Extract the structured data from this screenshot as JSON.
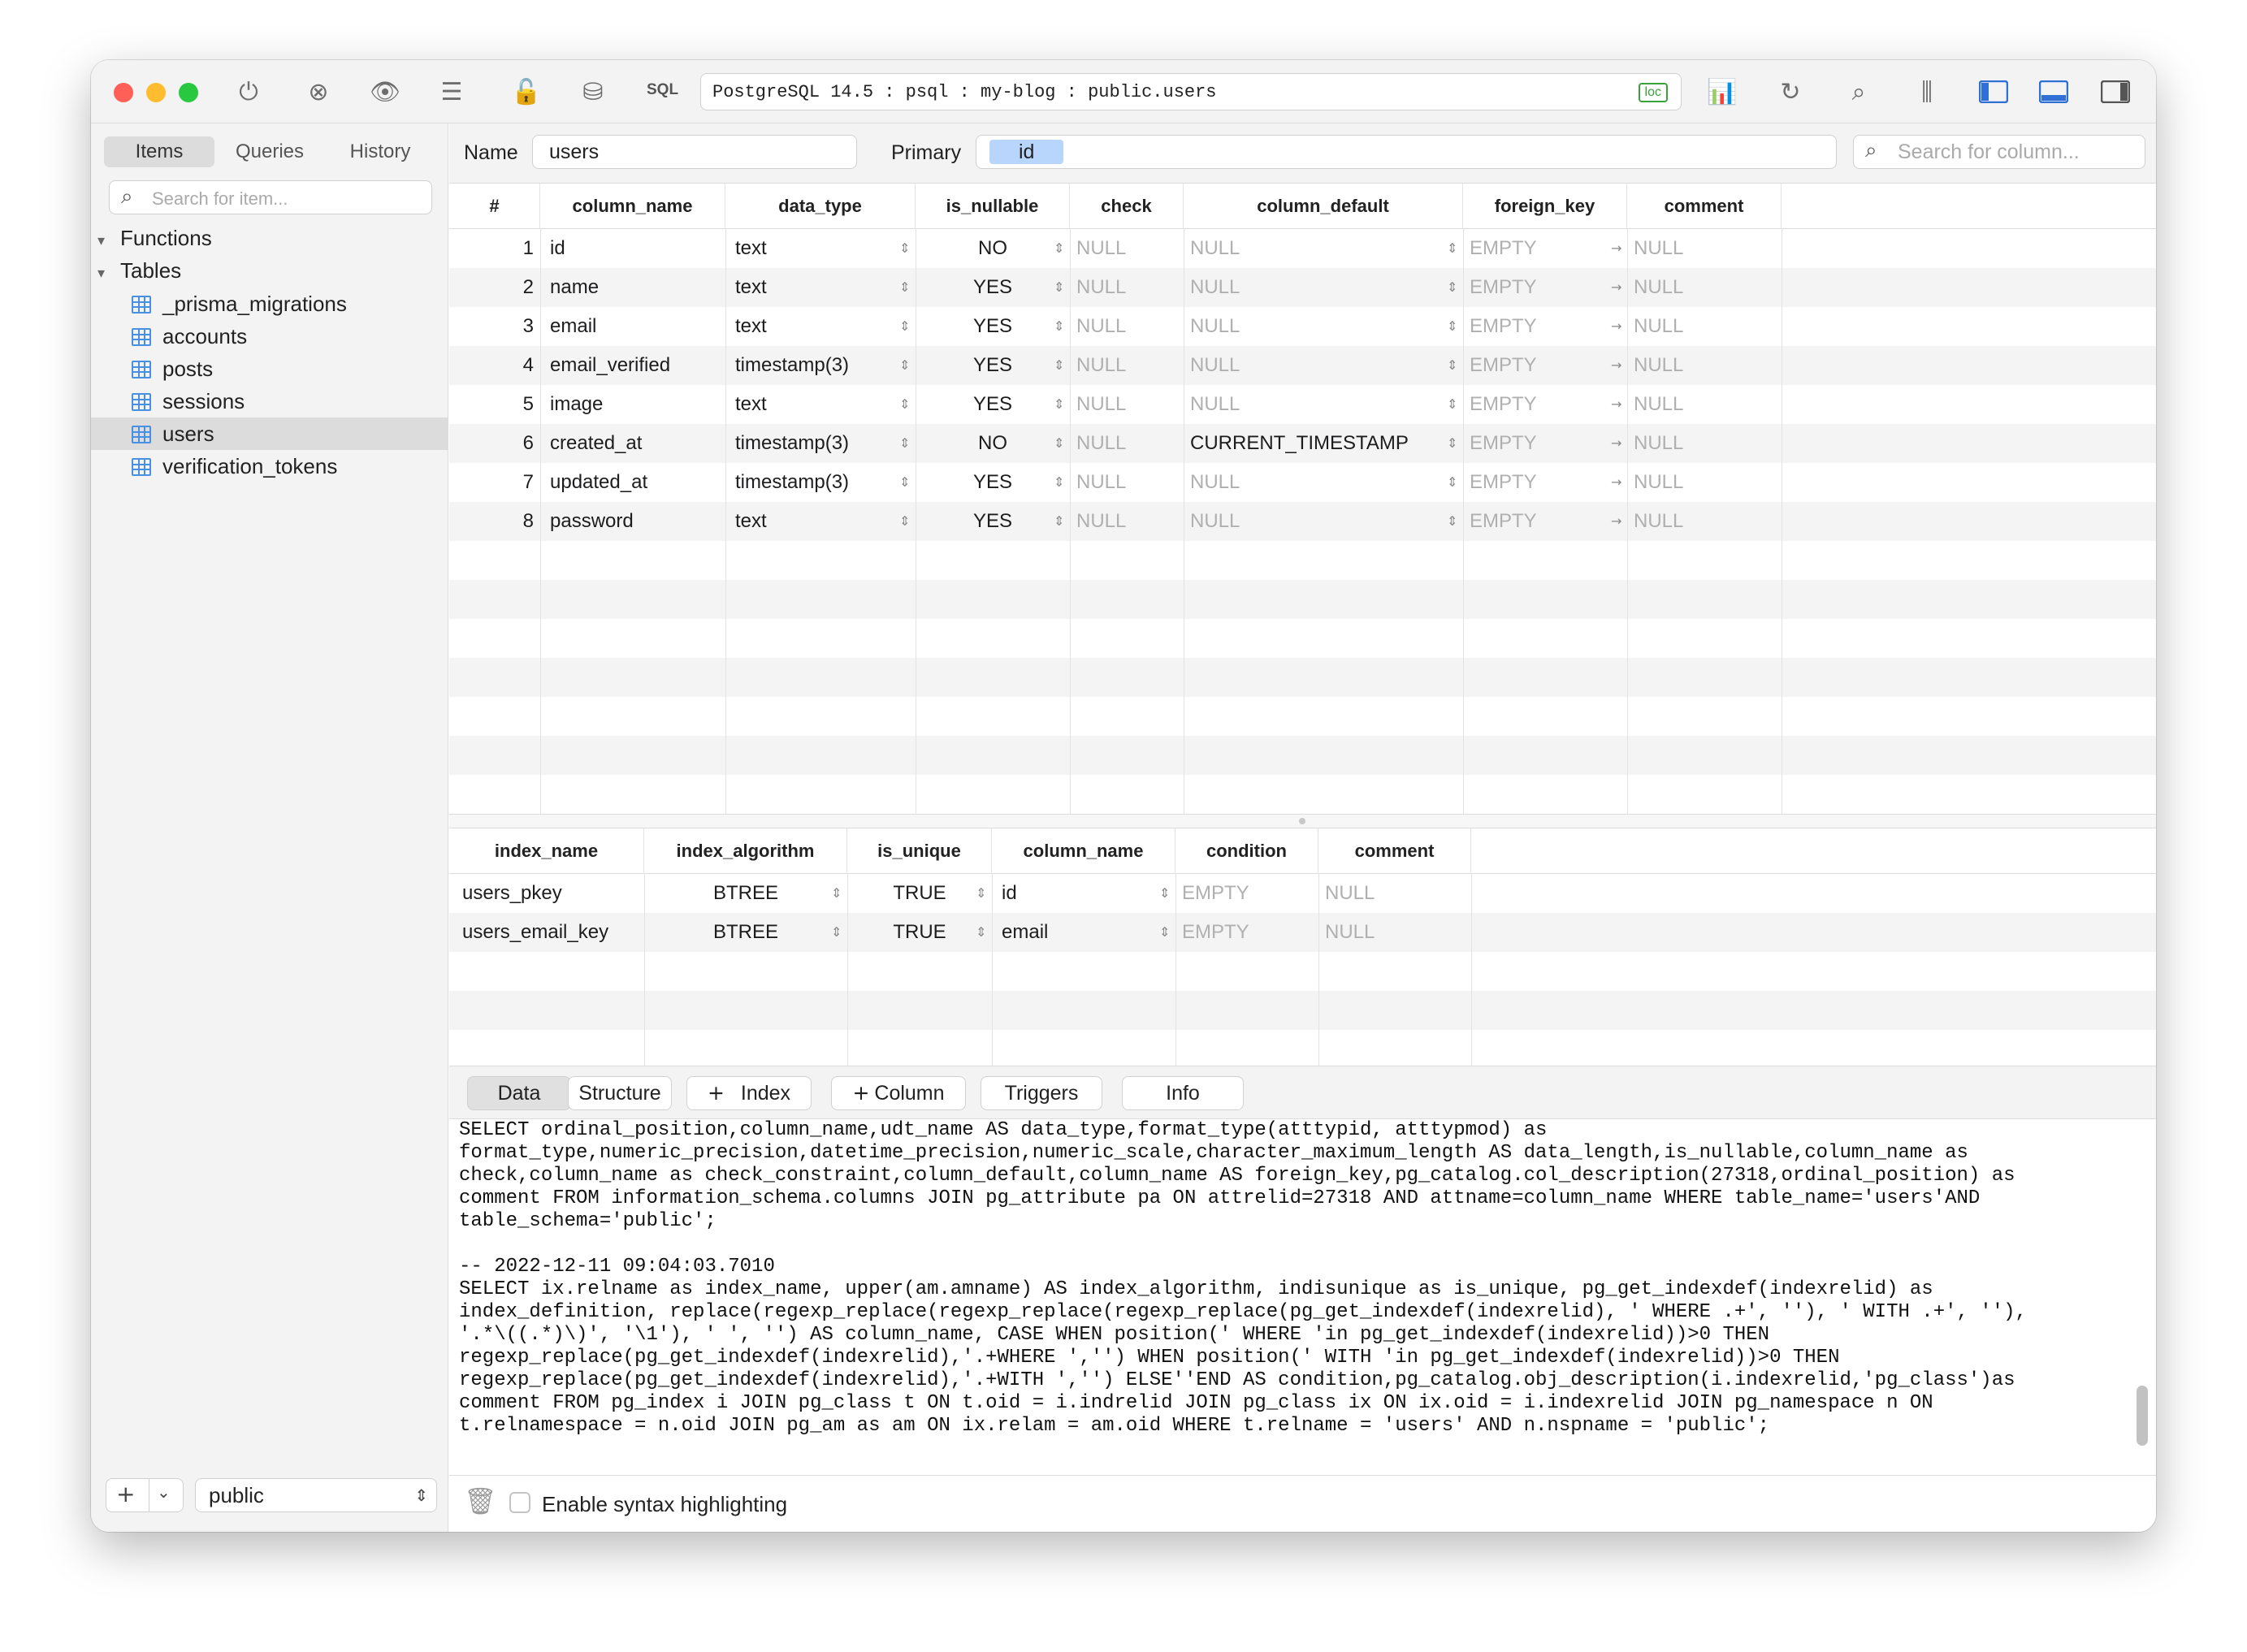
{
  "titlebar": {
    "connection": "PostgreSQL 14.5 : psql : my-blog : public.users",
    "badge": "loc",
    "sql_label": "SQL"
  },
  "sidebar": {
    "tabs": [
      "Items",
      "Queries",
      "History"
    ],
    "active_tab": "Items",
    "search_placeholder": "Search for item...",
    "sections": [
      {
        "label": "Functions",
        "expanded": true,
        "items": []
      },
      {
        "label": "Tables",
        "expanded": true,
        "items": [
          "_prisma_migrations",
          "accounts",
          "posts",
          "sessions",
          "users",
          "verification_tokens"
        ]
      }
    ],
    "selected_item": "users",
    "add_label": "+",
    "schema": "public"
  },
  "structure": {
    "name_label": "Name",
    "name_value": "users",
    "primary_label": "Primary",
    "primary_value": "id",
    "search_placeholder": "Search for column...",
    "columns_headers": [
      "#",
      "column_name",
      "data_type",
      "is_nullable",
      "check",
      "column_default",
      "foreign_key",
      "comment"
    ],
    "columns_rows": [
      [
        "1",
        "id",
        "text",
        "NO",
        "NULL",
        "NULL",
        "EMPTY",
        "NULL"
      ],
      [
        "2",
        "name",
        "text",
        "YES",
        "NULL",
        "NULL",
        "EMPTY",
        "NULL"
      ],
      [
        "3",
        "email",
        "text",
        "YES",
        "NULL",
        "NULL",
        "EMPTY",
        "NULL"
      ],
      [
        "4",
        "email_verified",
        "timestamp(3)",
        "YES",
        "NULL",
        "NULL",
        "EMPTY",
        "NULL"
      ],
      [
        "5",
        "image",
        "text",
        "YES",
        "NULL",
        "NULL",
        "EMPTY",
        "NULL"
      ],
      [
        "6",
        "created_at",
        "timestamp(3)",
        "NO",
        "NULL",
        "CURRENT_TIMESTAMP",
        "EMPTY",
        "NULL"
      ],
      [
        "7",
        "updated_at",
        "timestamp(3)",
        "YES",
        "NULL",
        "NULL",
        "EMPTY",
        "NULL"
      ],
      [
        "8",
        "password",
        "text",
        "YES",
        "NULL",
        "NULL",
        "EMPTY",
        "NULL"
      ]
    ],
    "index_headers": [
      "index_name",
      "index_algorithm",
      "is_unique",
      "column_name",
      "condition",
      "comment"
    ],
    "index_rows": [
      [
        "users_pkey",
        "BTREE",
        "TRUE",
        "id",
        "EMPTY",
        "NULL"
      ],
      [
        "users_email_key",
        "BTREE",
        "TRUE",
        "email",
        "EMPTY",
        "NULL"
      ]
    ]
  },
  "bottom_tabs": {
    "data": "Data",
    "structure": "Structure",
    "index": "Index",
    "column": "Column",
    "triggers": "Triggers",
    "info": "Info",
    "active": "Structure"
  },
  "console": {
    "log": "SELECT ordinal_position,column_name,udt_name AS data_type,format_type(atttypid, atttypmod) as\nformat_type,numeric_precision,datetime_precision,numeric_scale,character_maximum_length AS data_length,is_nullable,column_name as\ncheck,column_name as check_constraint,column_default,column_name AS foreign_key,pg_catalog.col_description(27318,ordinal_position) as\ncomment FROM information_schema.columns JOIN pg_attribute pa ON attrelid=27318 AND attname=column_name WHERE table_name='users'AND\ntable_schema='public';\n\n-- 2022-12-11 09:04:03.7010\nSELECT ix.relname as index_name, upper(am.amname) AS index_algorithm, indisunique as is_unique, pg_get_indexdef(indexrelid) as\nindex_definition, replace(regexp_replace(regexp_replace(regexp_replace(pg_get_indexdef(indexrelid), ' WHERE .+', ''), ' WITH .+', ''),\n'.*\\((.*)\\)', '\\1'), ' ', '') AS column_name, CASE WHEN position(' WHERE 'in pg_get_indexdef(indexrelid))>0 THEN\nregexp_replace(pg_get_indexdef(indexrelid),'.+WHERE ','') WHEN position(' WITH 'in pg_get_indexdef(indexrelid))>0 THEN\nregexp_replace(pg_get_indexdef(indexrelid),'.+WITH ','') ELSE''END AS condition,pg_catalog.obj_description(i.indexrelid,'pg_class')as\ncomment FROM pg_index i JOIN pg_class t ON t.oid = i.indrelid JOIN pg_class ix ON ix.oid = i.indexrelid JOIN pg_namespace n ON\nt.relnamespace = n.oid JOIN pg_am as am ON ix.relam = am.oid WHERE t.relname = 'users' AND n.nspname = 'public';",
    "syntax_label": "Enable syntax highlighting"
  },
  "colors": {
    "accent": "#4a90e2",
    "selection": "#b8d6fb",
    "null_text": "#b0b0b0",
    "close": "#fe5f57",
    "minimize": "#febc2e",
    "zoom": "#28c840"
  }
}
